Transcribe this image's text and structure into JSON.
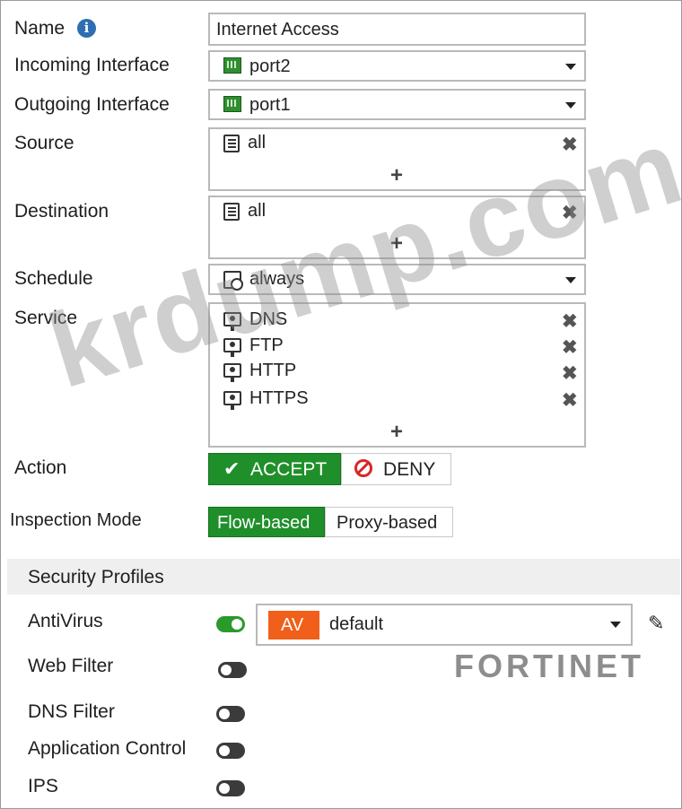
{
  "fields": {
    "name_label": "Name",
    "name_value": "Internet Access",
    "incoming_label": "Incoming Interface",
    "incoming_value": "port2",
    "outgoing_label": "Outgoing Interface",
    "outgoing_value": "port1",
    "source_label": "Source",
    "source_value": "all",
    "destination_label": "Destination",
    "destination_value": "all",
    "schedule_label": "Schedule",
    "schedule_value": "always",
    "service_label": "Service",
    "services": [
      "DNS",
      "FTP",
      "HTTP",
      "HTTPS"
    ],
    "action_label": "Action",
    "action_accept": "ACCEPT",
    "action_deny": "DENY",
    "inspection_label": "Inspection Mode",
    "inspection_flow": "Flow-based",
    "inspection_proxy": "Proxy-based"
  },
  "security_profiles": {
    "header": "Security Profiles",
    "antivirus_label": "AntiVirus",
    "av_badge": "AV",
    "av_profile": "default",
    "webfilter_label": "Web Filter",
    "dnsfilter_label": "DNS Filter",
    "appcontrol_label": "Application Control",
    "ips_label": "IPS"
  },
  "toggles": {
    "antivirus": true,
    "webfilter": false,
    "dnsfilter": false,
    "appcontrol": false,
    "ips": false
  },
  "icons": {
    "info": "info-icon",
    "port": "port-icon",
    "address": "address-icon",
    "schedule": "schedule-icon",
    "service": "service-icon",
    "remove": "close-icon",
    "add": "plus-icon",
    "edit": "pencil-icon"
  },
  "branding": {
    "logo": "FORTINET",
    "watermark": "krdump.com"
  },
  "colors": {
    "accept_green": "#1f8f2a",
    "av_orange": "#f0601a",
    "toggle_on": "#2a9a2a"
  }
}
